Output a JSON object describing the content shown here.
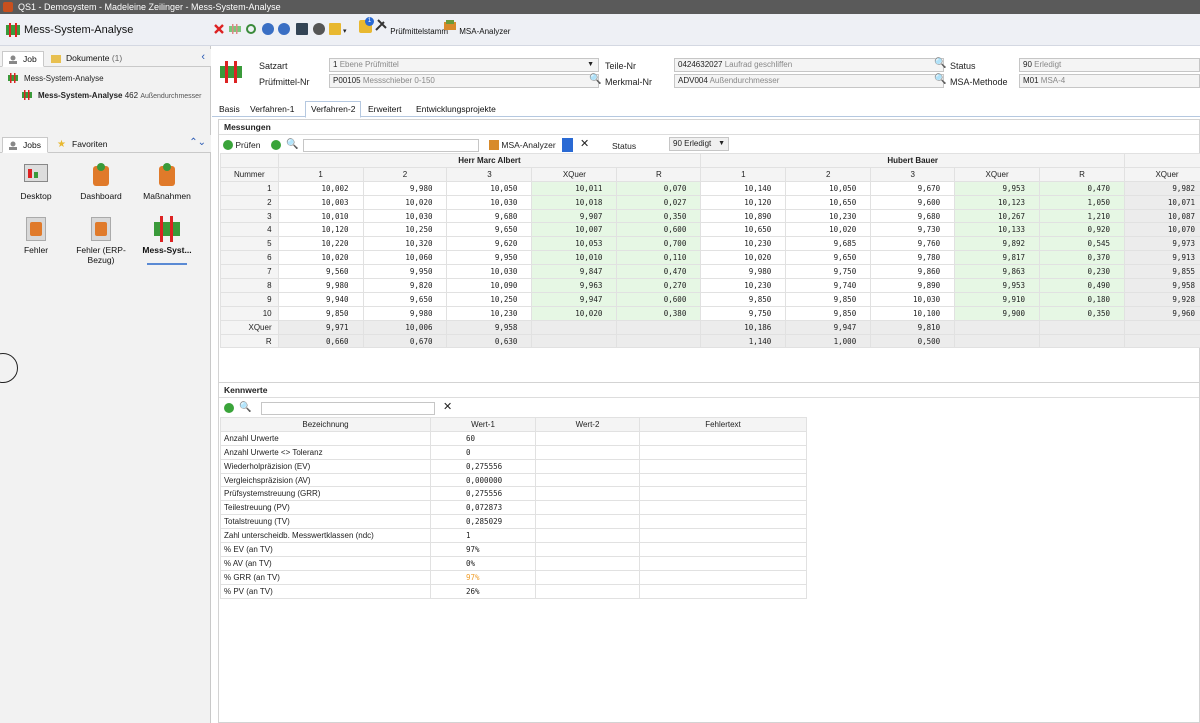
{
  "window": {
    "title": "QS1 - Demosystem - Madeleine Zeilinger - Mess-System-Analyse"
  },
  "app": {
    "title": "Mess-System-Analyse",
    "toolbar": {
      "pruefmittelstamm": "Prüfmittelstamm",
      "msa_analyzer": "MSA-Analyzer",
      "badge": "1"
    }
  },
  "left": {
    "tabs": [
      {
        "label": "Job"
      },
      {
        "label": "Dokumente",
        "count": "(1)"
      }
    ],
    "tree": {
      "root": "Mess-System-Analyse",
      "child_bold": "Mess-System-Analyse",
      "child_num": "462",
      "child_desc": "Außendurchmesser"
    },
    "jobs_tabs": [
      {
        "label": "Jobs"
      },
      {
        "label": "Favoriten"
      }
    ],
    "tiles": [
      "Desktop",
      "Dashboard",
      "Maßnahmen",
      "Fehler",
      "Fehler (ERP-Bezug)",
      "Mess-Syst..."
    ]
  },
  "header": {
    "satzart_label": "Satzart",
    "satzart_num": "1",
    "satzart_text": "Ebene Prüfmittel",
    "pruefmittel_label": "Prüfmittel-Nr",
    "pruefmittel_num": "P00105",
    "pruefmittel_text": "Messschieber 0-150",
    "teile_label": "Teile-Nr",
    "teile_num": "0424632027",
    "teile_text": "Laufrad geschliffen",
    "merkmal_label": "Merkmal-Nr",
    "merkmal_num": "ADV004",
    "merkmal_text": "Außendurchmesser",
    "status_label": "Status",
    "status_num": "90",
    "status_text": "Erledigt",
    "methode_label": "MSA-Methode",
    "methode_num": "M01",
    "methode_text": "MSA-4"
  },
  "tabs": [
    "Basis",
    "Verfahren-1",
    "Verfahren-2",
    "Erweitert",
    "Entwicklungsprojekte"
  ],
  "messungen": {
    "title": "Messungen",
    "pruefen": "Prüfen",
    "msa_analyzer": "MSA-Analyzer",
    "status_label": "Status",
    "status_value": "90 Erledigt",
    "op1": "Herr Marc Albert",
    "op2": "Hubert Bauer",
    "cols": [
      "Nummer",
      "1",
      "2",
      "3",
      "XQuer",
      "R",
      "1",
      "2",
      "3",
      "XQuer",
      "R",
      "XQuer"
    ],
    "rows": [
      [
        "1",
        "10,002",
        "9,980",
        "10,050",
        "10,011",
        "0,070",
        "10,140",
        "10,050",
        "9,670",
        "9,953",
        "0,470",
        "9,982"
      ],
      [
        "2",
        "10,003",
        "10,020",
        "10,030",
        "10,018",
        "0,027",
        "10,120",
        "10,650",
        "9,600",
        "10,123",
        "1,050",
        "10,071"
      ],
      [
        "3",
        "10,010",
        "10,030",
        "9,680",
        "9,907",
        "0,350",
        "10,890",
        "10,230",
        "9,680",
        "10,267",
        "1,210",
        "10,087"
      ],
      [
        "4",
        "10,120",
        "10,250",
        "9,650",
        "10,007",
        "0,600",
        "10,650",
        "10,020",
        "9,730",
        "10,133",
        "0,920",
        "10,070"
      ],
      [
        "5",
        "10,220",
        "10,320",
        "9,620",
        "10,053",
        "0,700",
        "10,230",
        "9,685",
        "9,760",
        "9,892",
        "0,545",
        "9,973"
      ],
      [
        "6",
        "10,020",
        "10,060",
        "9,950",
        "10,010",
        "0,110",
        "10,020",
        "9,650",
        "9,780",
        "9,817",
        "0,370",
        "9,913"
      ],
      [
        "7",
        "9,560",
        "9,950",
        "10,030",
        "9,847",
        "0,470",
        "9,980",
        "9,750",
        "9,860",
        "9,863",
        "0,230",
        "9,855"
      ],
      [
        "8",
        "9,980",
        "9,820",
        "10,090",
        "9,963",
        "0,270",
        "10,230",
        "9,740",
        "9,890",
        "9,953",
        "0,490",
        "9,958"
      ],
      [
        "9",
        "9,940",
        "9,650",
        "10,250",
        "9,947",
        "0,600",
        "9,850",
        "9,850",
        "10,030",
        "9,910",
        "0,180",
        "9,928"
      ],
      [
        "10",
        "9,850",
        "9,980",
        "10,230",
        "10,020",
        "0,380",
        "9,750",
        "9,850",
        "10,100",
        "9,900",
        "0,350",
        "9,960"
      ]
    ],
    "xquer_row": [
      "XQuer",
      "9,971",
      "10,006",
      "9,958",
      "",
      "",
      "10,186",
      "9,947",
      "9,810",
      "",
      "",
      ""
    ],
    "r_row": [
      "R",
      "0,660",
      "0,670",
      "0,630",
      "",
      "",
      "1,140",
      "1,000",
      "0,500",
      "",
      "",
      ""
    ]
  },
  "kennwerte": {
    "title": "Kennwerte",
    "cols": [
      "Bezeichnung",
      "Wert-1",
      "Wert-2",
      "Fehlertext"
    ],
    "rows": [
      [
        "Anzahl Urwerte",
        "60"
      ],
      [
        "Anzahl Urwerte <> Toleranz",
        "0"
      ],
      [
        "Wiederholpräzision (EV)",
        "0,275556"
      ],
      [
        "Vergleichspräzision (AV)",
        "0,000000"
      ],
      [
        "Prüfsystemstreuung (GRR)",
        "0,275556"
      ],
      [
        "Teilestreuung (PV)",
        "0,072873"
      ],
      [
        "Totalstreuung (TV)",
        "0,285029"
      ],
      [
        "Zahl unterscheidb. Messwertklassen (ndc)",
        "1"
      ],
      [
        "% EV (an TV)",
        "97%"
      ],
      [
        "% AV (an TV)",
        "0%"
      ],
      [
        "% GRR (an TV)",
        "97%"
      ],
      [
        "% PV (an TV)",
        "26%"
      ]
    ],
    "highlight_color": "#f0a030"
  }
}
